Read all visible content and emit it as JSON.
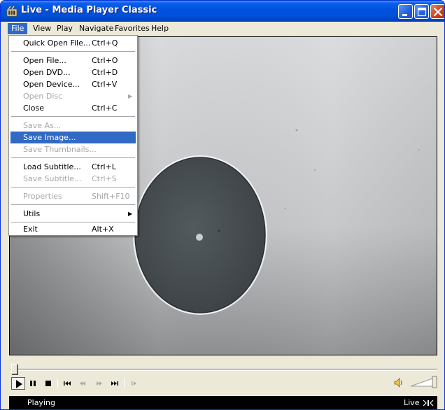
{
  "window": {
    "title": "Live - Media Player Classic",
    "accent_color": "#0053e1"
  },
  "menubar": {
    "items": [
      {
        "label": "File"
      },
      {
        "label": "View"
      },
      {
        "label": "Play"
      },
      {
        "label": "Navigate"
      },
      {
        "label": "Favorites"
      },
      {
        "label": "Help"
      }
    ]
  },
  "file_menu": {
    "items": [
      {
        "label": "Quick Open File...",
        "shortcut": "Ctrl+Q"
      },
      {
        "label": "Open File...",
        "shortcut": "Ctrl+O"
      },
      {
        "label": "Open DVD...",
        "shortcut": "Ctrl+D"
      },
      {
        "label": "Open Device...",
        "shortcut": "Ctrl+V"
      },
      {
        "label": "Open Disc",
        "shortcut": ""
      },
      {
        "label": "Close",
        "shortcut": "Ctrl+C"
      },
      {
        "label": "Save As...",
        "shortcut": ""
      },
      {
        "label": "Save Image...",
        "shortcut": ""
      },
      {
        "label": "Save Thumbnails...",
        "shortcut": ""
      },
      {
        "label": "Load Subtitle...",
        "shortcut": "Ctrl+L"
      },
      {
        "label": "Save Subtitle...",
        "shortcut": "Ctrl+S"
      },
      {
        "label": "Properties",
        "shortcut": "Shift+F10"
      },
      {
        "label": "Utils",
        "shortcut": ""
      },
      {
        "label": "Exit",
        "shortcut": "Alt+X"
      }
    ],
    "highlight_color": "#316ac5"
  },
  "playback": {
    "seek_position": 0,
    "controls": [
      "play-icon",
      "pause-icon",
      "stop-icon",
      "skip-back-icon",
      "rewind-icon",
      "fast-forward-icon",
      "skip-forward-icon",
      "frame-step-icon"
    ]
  },
  "status": {
    "state": "Playing",
    "source": "Live"
  }
}
